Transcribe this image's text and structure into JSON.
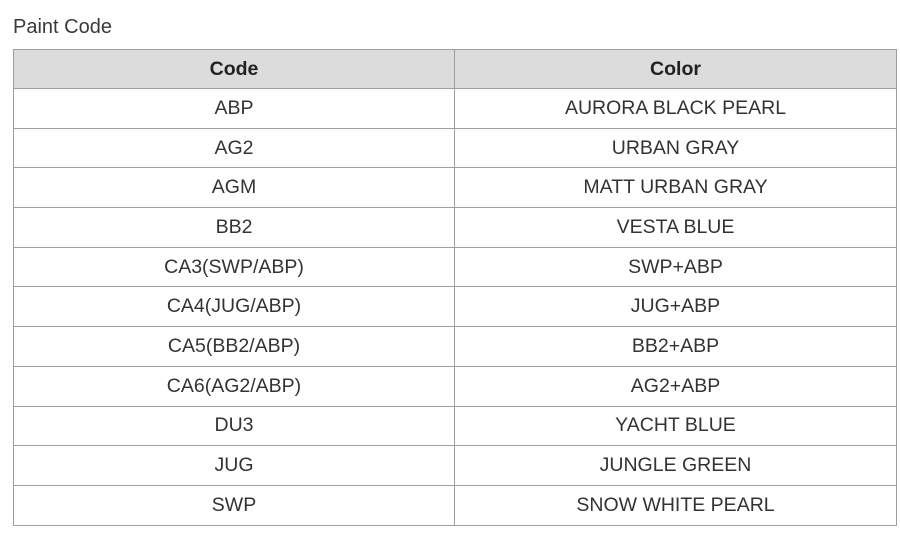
{
  "caption": "Paint Code",
  "table": {
    "headers": [
      "Code",
      "Color"
    ],
    "rows": [
      [
        "ABP",
        "AURORA BLACK PEARL"
      ],
      [
        "AG2",
        "URBAN GRAY"
      ],
      [
        "AGM",
        "MATT URBAN GRAY"
      ],
      [
        "BB2",
        "VESTA BLUE"
      ],
      [
        "CA3(SWP/ABP)",
        "SWP+ABP"
      ],
      [
        "CA4(JUG/ABP)",
        "JUG+ABP"
      ],
      [
        "CA5(BB2/ABP)",
        "BB2+ABP"
      ],
      [
        "CA6(AG2/ABP)",
        "AG2+ABP"
      ],
      [
        "DU3",
        "YACHT BLUE"
      ],
      [
        "JUG",
        "JUNGLE GREEN"
      ],
      [
        "SWP",
        "SNOW WHITE PEARL"
      ]
    ]
  }
}
